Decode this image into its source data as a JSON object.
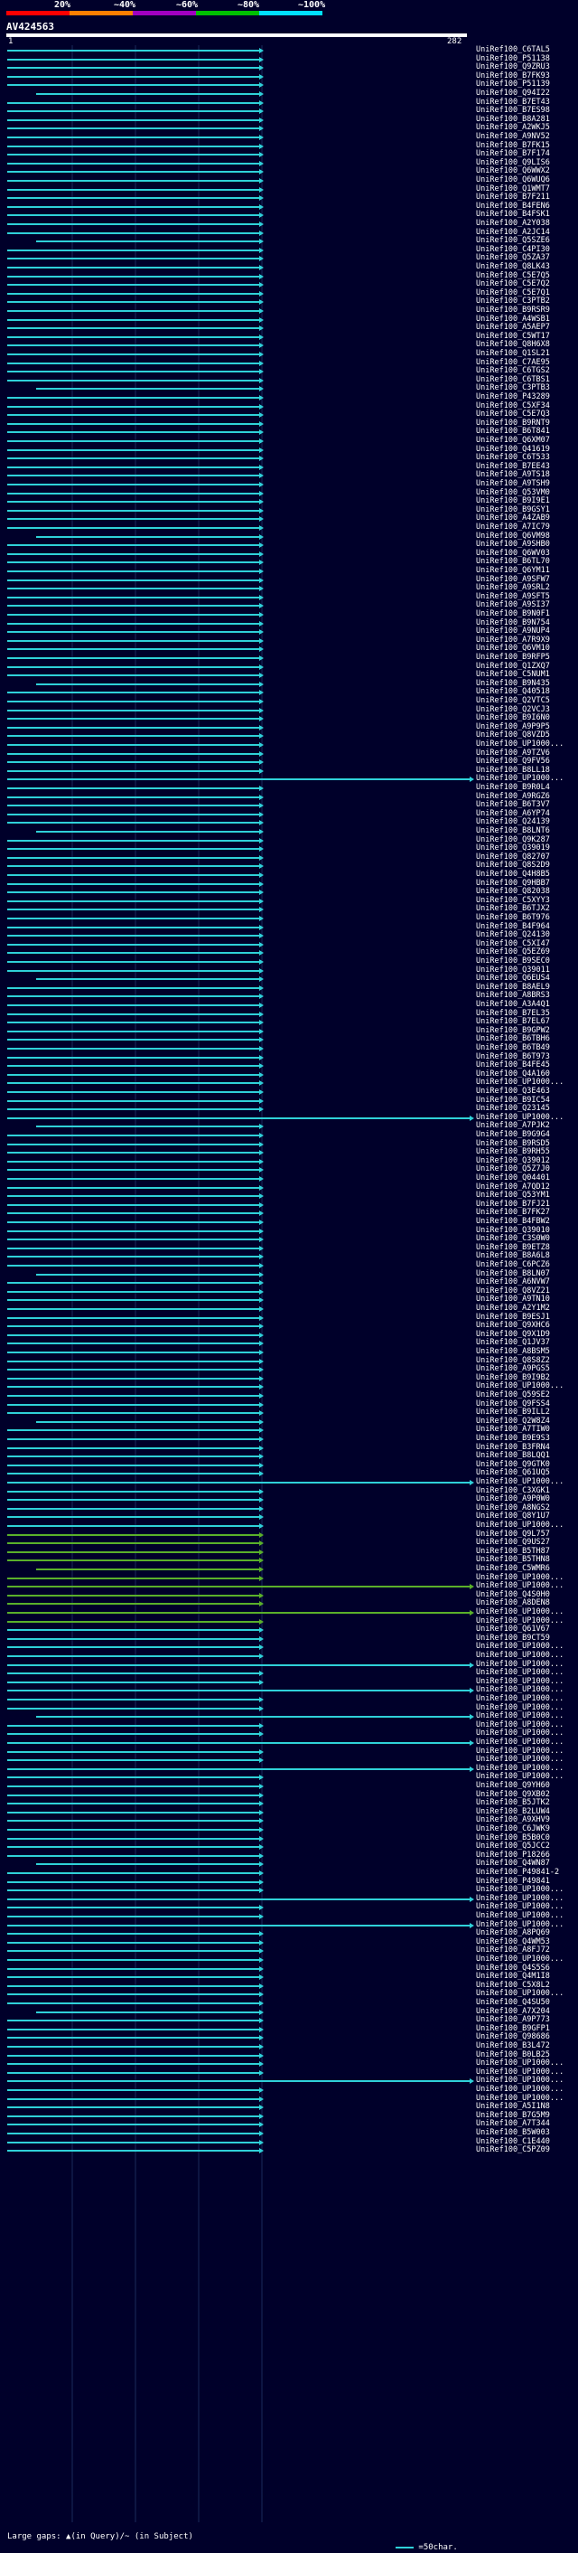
{
  "scale": {
    "labels": [
      "20%",
      "~40%",
      "~60%",
      "~80%",
      "~100%"
    ],
    "colors": [
      "#ff0000",
      "#ff7f00",
      "#a000c0",
      "#00c000",
      "#00e0ff"
    ]
  },
  "query": {
    "title": "AV424563",
    "start": "1",
    "end": "282"
  },
  "hits": [
    "UniRef100_C6TAL5",
    "UniRef100_P51138",
    "UniRef100_Q9ZRU3",
    "UniRef100_B7FK93",
    "UniRef100_P51139",
    "UniRef100_Q94I22",
    "UniRef100_B7ET43",
    "UniRef100_B7ES98",
    "UniRef100_B8A281",
    "UniRef100_A2WKJ5",
    "UniRef100_A9NV52",
    "UniRef100_B7FK15",
    "UniRef100_B7F174",
    "UniRef100_Q9LIS6",
    "UniRef100_Q6WWX2",
    "UniRef100_Q6WUQ6",
    "UniRef100_Q1WMT7",
    "UniRef100_B7F211",
    "UniRef100_B4FEN6",
    "UniRef100_B4FSK1",
    "UniRef100_A2Y038",
    "UniRef100_A2JC14",
    "UniRef100_Q5SZE6",
    "UniRef100_C4PI30",
    "UniRef100_Q5ZA37",
    "UniRef100_Q8LK43",
    "UniRef100_C5E7Q5",
    "UniRef100_C5E7Q2",
    "UniRef100_C5E7Q1",
    "UniRef100_C3PTB2",
    "UniRef100_B9RSR9",
    "UniRef100_A4WSB1",
    "UniRef100_A5AEP7",
    "UniRef100_C5WT17",
    "UniRef100_Q8H6X8",
    "UniRef100_Q1SL21",
    "UniRef100_C7AE95",
    "UniRef100_C6TGS2",
    "UniRef100_C6TBS1",
    "UniRef100_C3PTB3",
    "UniRef100_P43289",
    "UniRef100_C5XF34",
    "UniRef100_C5E7Q3",
    "UniRef100_B9RNT9",
    "UniRef100_B6T841",
    "UniRef100_Q6XM07",
    "UniRef100_Q41619",
    "UniRef100_C6T533",
    "UniRef100_B7EE43",
    "UniRef100_A9TS18",
    "UniRef100_A9TSH9",
    "UniRef100_Q53VM0",
    "UniRef100_B9I9E1",
    "UniRef100_B9GSY1",
    "UniRef100_A4ZAB9",
    "UniRef100_A7IC79",
    "UniRef100_Q6VM98",
    "UniRef100_A9SHB0",
    "UniRef100_Q6WV03",
    "UniRef100_B6TL70",
    "UniRef100_Q6YM11",
    "UniRef100_A9SFW7",
    "UniRef100_A9SRL2",
    "UniRef100_A9SFT5",
    "UniRef100_A9SI37",
    "UniRef100_B9N0F1",
    "UniRef100_B9N754",
    "UniRef100_A9NUP4",
    "UniRef100_A7R9X9",
    "UniRef100_Q6VM10",
    "UniRef100_B9RFP5",
    "UniRef100_Q1ZXQ7",
    "UniRef100_C5NUM1",
    "UniRef100_B9N435",
    "UniRef100_Q40518",
    "UniRef100_Q2VTC5",
    "UniRef100_Q2VCJ3",
    "UniRef100_B9I6N0",
    "UniRef100_A9P9P5",
    "UniRef100_Q8VZD5",
    "UniRef100_UP1000...",
    "UniRef100_A9TZV6",
    "UniRef100_Q9FV56",
    "UniRef100_B8LL18",
    "UniRef100_UP1000...",
    "UniRef100_B9R0L4",
    "UniRef100_A9RGZ6",
    "UniRef100_B6T3V7",
    "UniRef100_A6YP74",
    "UniRef100_Q24139",
    "UniRef100_B8LNT6",
    "UniRef100_Q9K287",
    "UniRef100_Q39019",
    "UniRef100_Q82707",
    "UniRef100_Q8S2D9",
    "UniRef100_Q4H8B5",
    "UniRef100_Q9HBB7",
    "UniRef100_Q82038",
    "UniRef100_C5XYY3",
    "UniRef100_B6TJX2",
    "UniRef100_B6T976",
    "UniRef100_B4F964",
    "UniRef100_Q24130",
    "UniRef100_C5XI47",
    "UniRef100_Q5EZ69",
    "UniRef100_B9SEC0",
    "UniRef100_Q39011",
    "UniRef100_Q6EUS4",
    "UniRef100_B8AEL9",
    "UniRef100_A8BRS3",
    "UniRef100_A3A4Q1",
    "UniRef100_B7EL35",
    "UniRef100_B7EL67",
    "UniRef100_B9GPW2",
    "UniRef100_B6TBH6",
    "UniRef100_B6TB49",
    "UniRef100_B6T973",
    "UniRef100_B4FE45",
    "UniRef100_Q4A160",
    "UniRef100_UP1000...",
    "UniRef100_Q3E463",
    "UniRef100_B9IC54",
    "UniRef100_Q23145",
    "UniRef100_UP1000...",
    "UniRef100_A7PJK2",
    "UniRef100_B9G9G4",
    "UniRef100_B9RSD5",
    "UniRef100_B9RH55",
    "UniRef100_Q39012",
    "UniRef100_Q5Z7J0",
    "UniRef100_Q04401",
    "UniRef100_A7QD12",
    "UniRef100_Q53YM1",
    "UniRef100_B7FJ21",
    "UniRef100_B7FK27",
    "UniRef100_B4FBW2",
    "UniRef100_Q39010",
    "UniRef100_C3S0W0",
    "UniRef100_B9ETZ8",
    "UniRef100_B8A6L8",
    "UniRef100_C6PCZ6",
    "UniRef100_B8LN07",
    "UniRef100_A6NVW7",
    "UniRef100_Q8VZ21",
    "UniRef100_A9TN10",
    "UniRef100_A2Y1M2",
    "UniRef100_B9ESJ1",
    "UniRef100_Q9XHC6",
    "UniRef100_Q9X1D9",
    "UniRef100_Q1JV37",
    "UniRef100_A8BSM5",
    "UniRef100_Q8S8Z2",
    "UniRef100_A9PGS5",
    "UniRef100_B9I9B2",
    "UniRef100_UP1000...",
    "UniRef100_Q59SE2",
    "UniRef100_Q9FSS4",
    "UniRef100_B9ILL2",
    "UniRef100_Q2W8Z4",
    "UniRef100_A7TIW0",
    "UniRef100_B9E9S3",
    "UniRef100_B3FRN4",
    "UniRef100_B8LQQ1",
    "UniRef100_Q9GTK0",
    "UniRef100_Q61UQ5",
    "UniRef100_UP1000...",
    "UniRef100_C3XGK1",
    "UniRef100_A9P0W0",
    "UniRef100_A8NGS2",
    "UniRef100_Q8Y1U7",
    "UniRef100_UP1000...",
    "UniRef100_Q9L757",
    "UniRef100_Q9US27",
    "UniRef100_B5TH87",
    "UniRef100_B5THN8",
    "UniRef100_C5WMR6",
    "UniRef100_UP1000...",
    "UniRef100_UP1000...",
    "UniRef100_Q4S0H0",
    "UniRef100_A8DEN8",
    "UniRef100_UP1000...",
    "UniRef100_UP1000...",
    "UniRef100_Q61V67",
    "UniRef100_B9CT59",
    "UniRef100_UP1000...",
    "UniRef100_UP1000...",
    "UniRef100_UP1000...",
    "UniRef100_UP1000...",
    "UniRef100_UP1000...",
    "UniRef100_UP1000...",
    "UniRef100_UP1000...",
    "UniRef100_UP1000...",
    "UniRef100_UP1000...",
    "UniRef100_UP1000...",
    "UniRef100_UP1000...",
    "UniRef100_UP1000...",
    "UniRef100_UP1000...",
    "UniRef100_UP1000...",
    "UniRef100_UP1000...",
    "UniRef100_UP1000...",
    "UniRef100_Q9YH60",
    "UniRef100_Q9XB02",
    "UniRef100_B5JTK2",
    "UniRef100_B2LUW4",
    "UniRef100_A9XHV9",
    "UniRef100_C6JWK9",
    "UniRef100_B5B0C0",
    "UniRef100_Q5JCC2",
    "UniRef100_P18266",
    "UniRef100_Q4WN87",
    "UniRef100_P49841-2",
    "UniRef100_P49841",
    "UniRef100_UP1000...",
    "UniRef100_UP1000...",
    "UniRef100_UP1000...",
    "UniRef100_UP1000...",
    "UniRef100_UP1000...",
    "UniRef100_A8PQ69",
    "UniRef100_Q4WM53",
    "UniRef100_A8FJ72",
    "UniRef100_UP1000...",
    "UniRef100_Q4S5S6",
    "UniRef100_Q4M1I8",
    "UniRef100_C5X8L2",
    "UniRef100_UP1000...",
    "UniRef100_Q4SU50",
    "UniRef100_A7X204",
    "UniRef100_A9P773",
    "UniRef100_B9GFP1",
    "UniRef100_Q98686",
    "UniRef100_B3L472",
    "UniRef100_B0LB25",
    "UniRef100_UP1000...",
    "UniRef100_UP1000...",
    "UniRef100_UP1000...",
    "UniRef100_UP1000...",
    "UniRef100_UP1000...",
    "UniRef100_A5I1N8",
    "UniRef100_B7G5M9",
    "UniRef100_A7T344",
    "UniRef100_B5W003",
    "UniRef100_C1E440",
    "UniRef100_C5PZ09"
  ],
  "footer": {
    "large_gaps": "Large gaps: ▲(in Query)/~ (in Subject)",
    "legend": "=50char."
  }
}
